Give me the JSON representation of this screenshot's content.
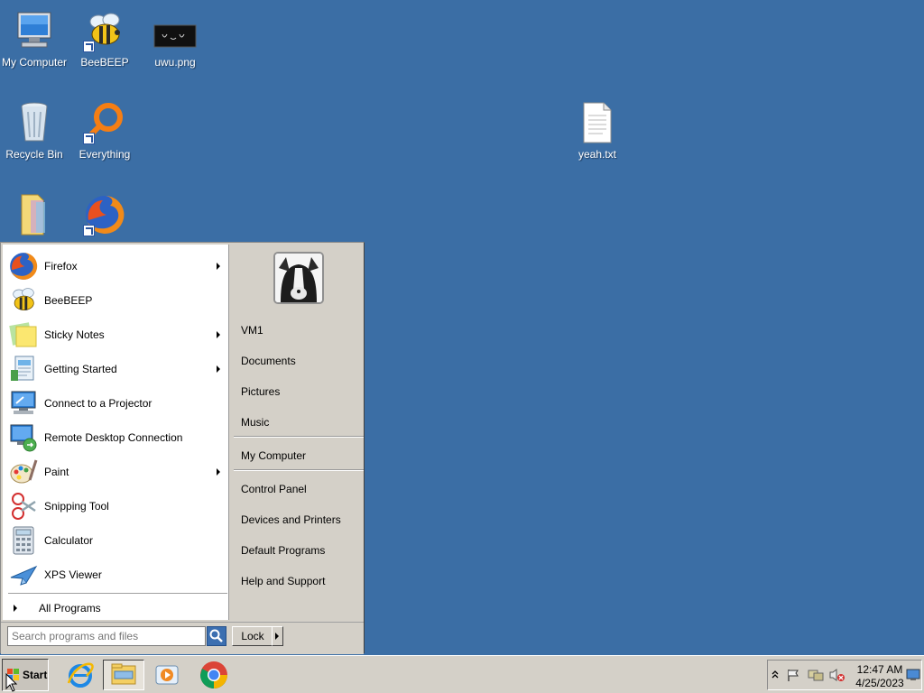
{
  "desktop": {
    "icons": [
      {
        "label": "My Computer",
        "icon": "computer-icon"
      },
      {
        "label": "BeeBEEP",
        "icon": "bee-icon"
      },
      {
        "label": "uwu.png",
        "icon": "image-file-icon"
      },
      {
        "label": "Recycle Bin",
        "icon": "recycle-bin-icon"
      },
      {
        "label": "Everything",
        "icon": "everything-icon"
      },
      {
        "label": "yeah.txt",
        "icon": "text-file-icon"
      },
      {
        "label": "",
        "icon": "folder-icon"
      },
      {
        "label": "",
        "icon": "firefox-icon"
      }
    ],
    "thumbnail_text": "(ˆ‿ˆ)"
  },
  "start_menu": {
    "programs": [
      {
        "label": "Firefox",
        "icon": "firefox-icon",
        "has_submenu": true
      },
      {
        "label": "BeeBEEP",
        "icon": "bee-icon",
        "has_submenu": false
      },
      {
        "label": "Sticky Notes",
        "icon": "sticky-notes-icon",
        "has_submenu": true
      },
      {
        "label": "Getting Started",
        "icon": "getting-started-icon",
        "has_submenu": true
      },
      {
        "label": "Connect to a Projector",
        "icon": "projector-icon",
        "has_submenu": false
      },
      {
        "label": "Remote Desktop Connection",
        "icon": "remote-desktop-icon",
        "has_submenu": false
      },
      {
        "label": "Paint",
        "icon": "paint-icon",
        "has_submenu": true
      },
      {
        "label": "Snipping Tool",
        "icon": "snipping-tool-icon",
        "has_submenu": false
      },
      {
        "label": "Calculator",
        "icon": "calculator-icon",
        "has_submenu": false
      },
      {
        "label": "XPS Viewer",
        "icon": "xps-viewer-icon",
        "has_submenu": false
      }
    ],
    "all_programs_label": "All Programs",
    "places": {
      "user": "VM1",
      "documents": "Documents",
      "pictures": "Pictures",
      "music": "Music",
      "my_computer": "My Computer",
      "control_panel": "Control Panel",
      "devices_printers": "Devices and Printers",
      "default_programs": "Default Programs",
      "help_support": "Help and Support"
    },
    "search_placeholder": "Search programs and files",
    "lock_label": "Lock"
  },
  "taskbar": {
    "start_label": "Start",
    "pinned": [
      "internet-explorer-icon",
      "file-explorer-icon",
      "media-player-icon",
      "chrome-icon"
    ],
    "clock_time": "12:47 AM",
    "clock_date": "4/25/2023",
    "tray_icons": [
      "show-hidden-icons-chevron",
      "action-center-flag-icon",
      "network-icon",
      "volume-muted-icon",
      "show-desktop-icon"
    ]
  }
}
